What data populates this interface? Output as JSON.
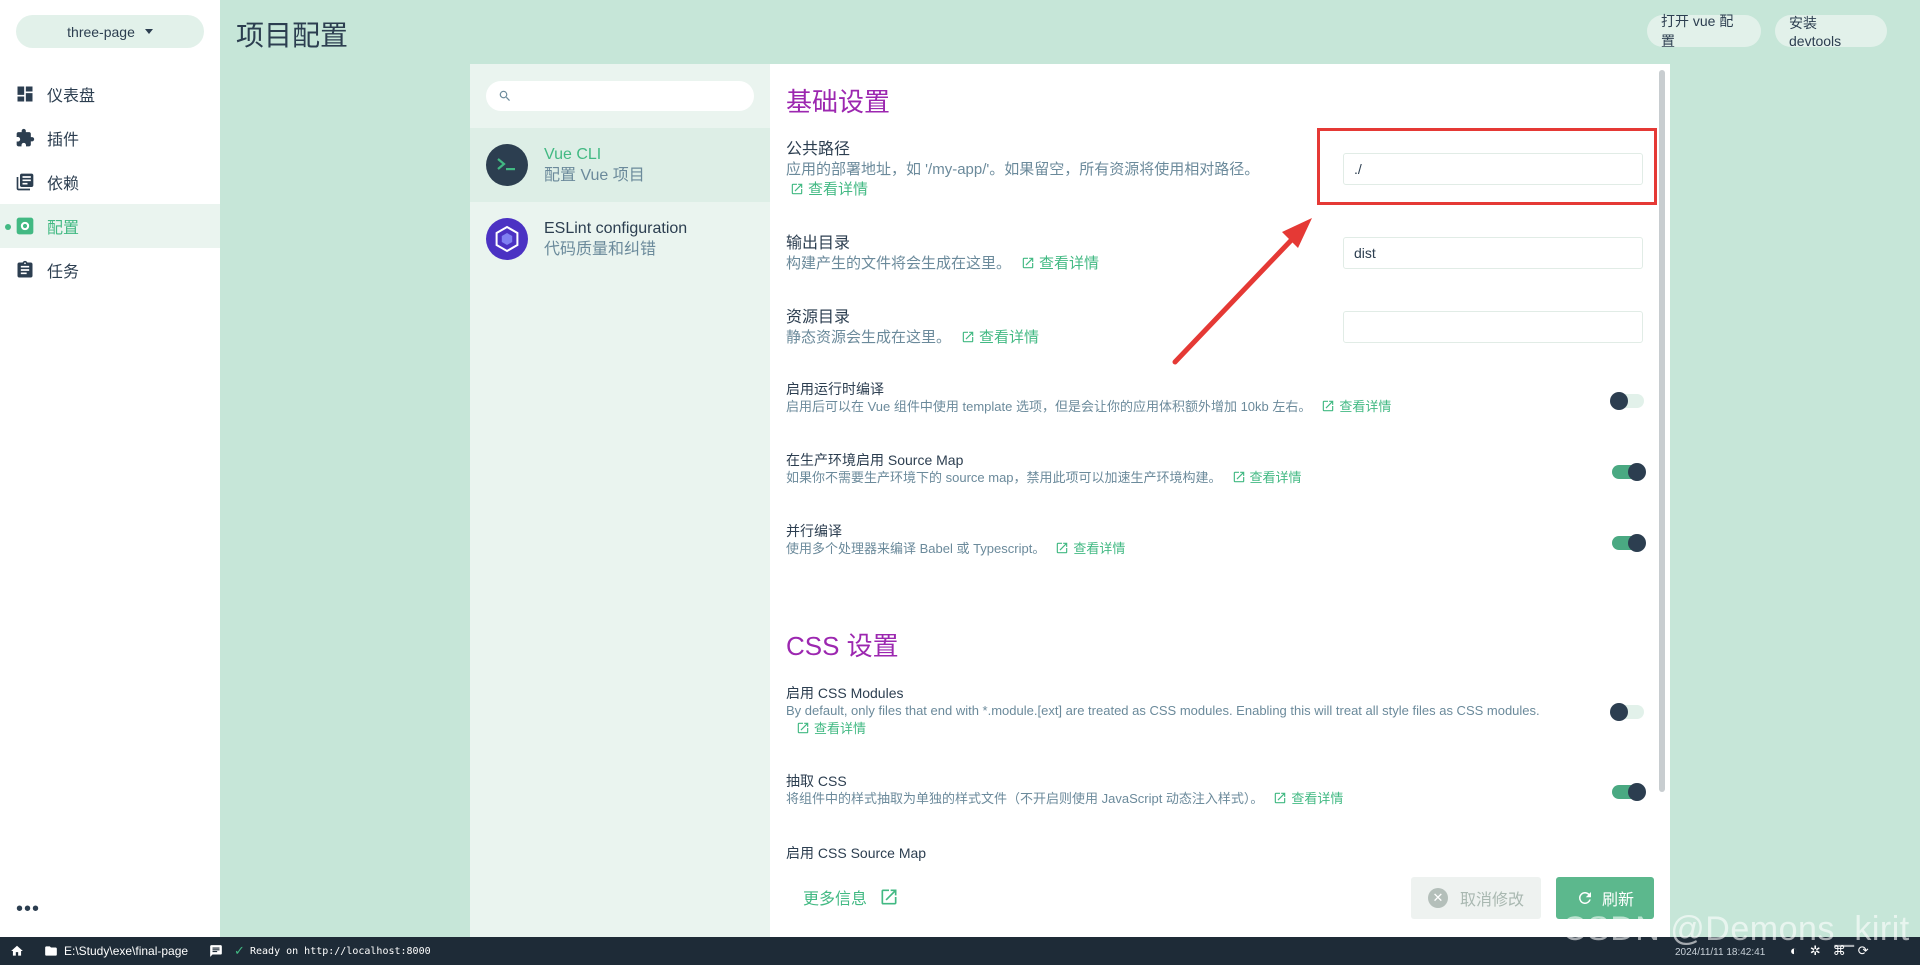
{
  "sidebar": {
    "project_name": "three-page",
    "nav": [
      {
        "label": "仪表盘",
        "icon": "dashboard-icon"
      },
      {
        "label": "插件",
        "icon": "puzzle-icon"
      },
      {
        "label": "依赖",
        "icon": "library-icon"
      },
      {
        "label": "配置",
        "icon": "gear-icon",
        "active": true
      },
      {
        "label": "任务",
        "icon": "clipboard-icon"
      }
    ],
    "more_label": "•••"
  },
  "header": {
    "title": "项目配置",
    "open_config_label": "打开 vue 配置",
    "install_devtools_label": "安装 devtools"
  },
  "plugins": {
    "search_placeholder": "",
    "items": [
      {
        "name": "Vue CLI",
        "desc": "配置 Vue 项目",
        "active": true
      },
      {
        "name": "ESLint configuration",
        "desc": "代码质量和纠错"
      }
    ]
  },
  "settings": {
    "basic_title": "基础设置",
    "css_title": "CSS 设置",
    "more_link_label": "查看详情",
    "public_path": {
      "label": "公共路径",
      "desc": "应用的部署地址，如 '/my-app/'。如果留空，所有资源将使用相对路径。",
      "value": "./"
    },
    "output_dir": {
      "label": "输出目录",
      "desc": "构建产生的文件将会生成在这里。",
      "value": "dist"
    },
    "assets_dir": {
      "label": "资源目录",
      "desc": "静态资源会生成在这里。",
      "value": ""
    },
    "runtime_compiler": {
      "label": "启用运行时编译",
      "desc": "启用后可以在 Vue 组件中使用 template 选项，但是会让你的应用体积额外增加 10kb 左右。",
      "enabled": false
    },
    "prod_source_map": {
      "label": "在生产环境启用 Source Map",
      "desc": "如果你不需要生产环境下的 source map，禁用此项可以加速生产环境构建。",
      "enabled": true
    },
    "parallel": {
      "label": "并行编译",
      "desc": "使用多个处理器来编译 Babel 或 Typescript。",
      "enabled": true
    },
    "css_modules": {
      "label": "启用 CSS Modules",
      "desc": "By default, only files that end with *.module.[ext] are treated as CSS modules. Enabling this will treat all style files as CSS modules.",
      "enabled": false
    },
    "extract_css": {
      "label": "抽取 CSS",
      "desc": "将组件中的样式抽取为单独的样式文件（不开启则使用 JavaScript 动态注入样式）。",
      "enabled": true
    },
    "css_source_map": {
      "label": "启用 CSS Source Map",
      "enabled": false
    }
  },
  "footer": {
    "more_info_label": "更多信息",
    "cancel_label": "取消修改",
    "refresh_label": "刷新"
  },
  "statusbar": {
    "path": "E:\\Study\\exe\\final-page",
    "log": "Ready on http://localhost:8000",
    "time": "2024/11/11 18:42:41"
  },
  "watermark": "CSDN @Demons_kirit",
  "colors": {
    "accent": "#42b983",
    "section_title": "#9c27b0",
    "background": "#c6e6d8",
    "annotation": "#e53935"
  }
}
